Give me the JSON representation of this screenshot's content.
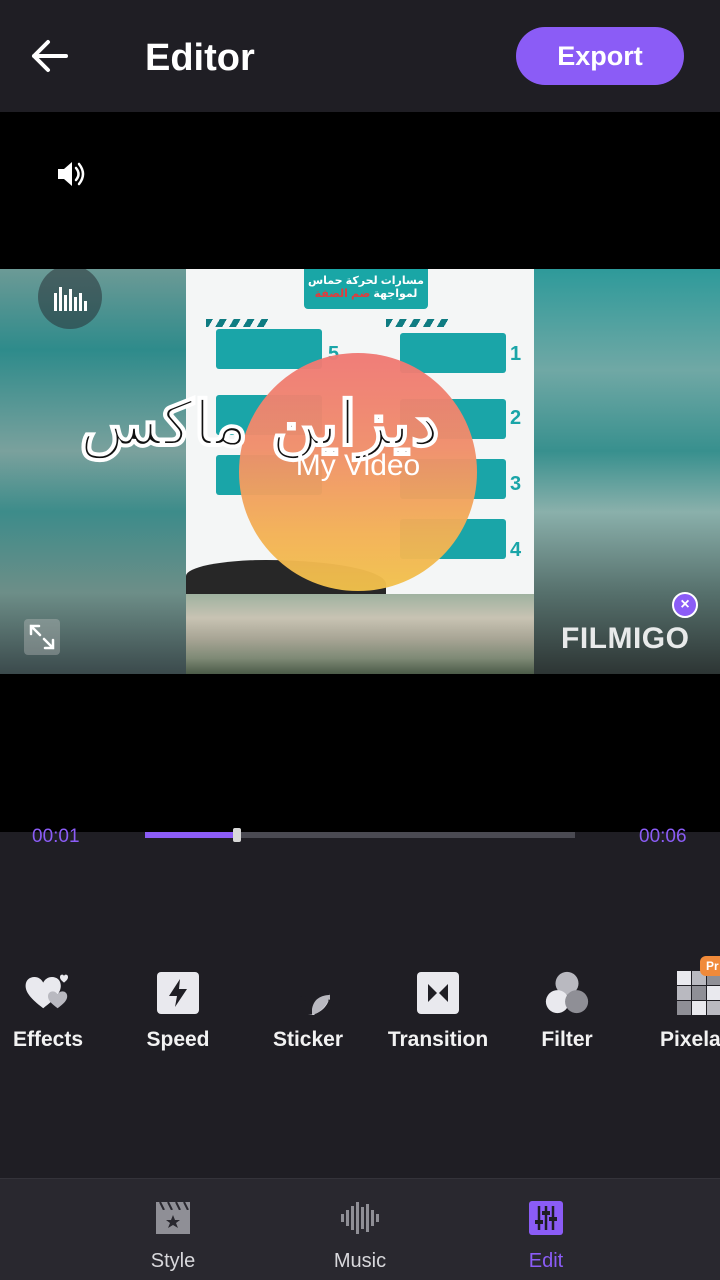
{
  "header": {
    "title": "Editor",
    "export_label": "Export"
  },
  "player": {
    "overlay_text": "My Video",
    "arabic_watermark": "ديزاين ماكس",
    "brand_watermark": "FILMIGO",
    "poster_title_line1": "مسارات لحركة حماس",
    "poster_title_line2": "لمواجهة",
    "poster_title_red": "ضم الضفة",
    "poster_numbers": [
      "1",
      "2",
      "3",
      "4",
      "5"
    ]
  },
  "timeline": {
    "current_time": "00:01",
    "total_time": "00:06",
    "progress": 0.215
  },
  "tools": [
    {
      "label": "Effects",
      "icon": "hearts-icon"
    },
    {
      "label": "Speed",
      "icon": "lightning-icon"
    },
    {
      "label": "Sticker",
      "icon": "sticker-icon"
    },
    {
      "label": "Transition",
      "icon": "transition-icon"
    },
    {
      "label": "Filter",
      "icon": "filter-circles-icon"
    },
    {
      "label": "Pixelat",
      "icon": "pixelate-icon",
      "badge": "Pr"
    }
  ],
  "bottom_nav": [
    {
      "label": "Style",
      "icon": "clapperboard-icon",
      "active": false
    },
    {
      "label": "Music",
      "icon": "waveform-icon",
      "active": false
    },
    {
      "label": "Edit",
      "icon": "sliders-icon",
      "active": true
    }
  ],
  "colors": {
    "accent": "#8b5cf6",
    "background": "#1f1e24",
    "nav_background": "#29282f",
    "pro_badge": "#f08a3a"
  }
}
